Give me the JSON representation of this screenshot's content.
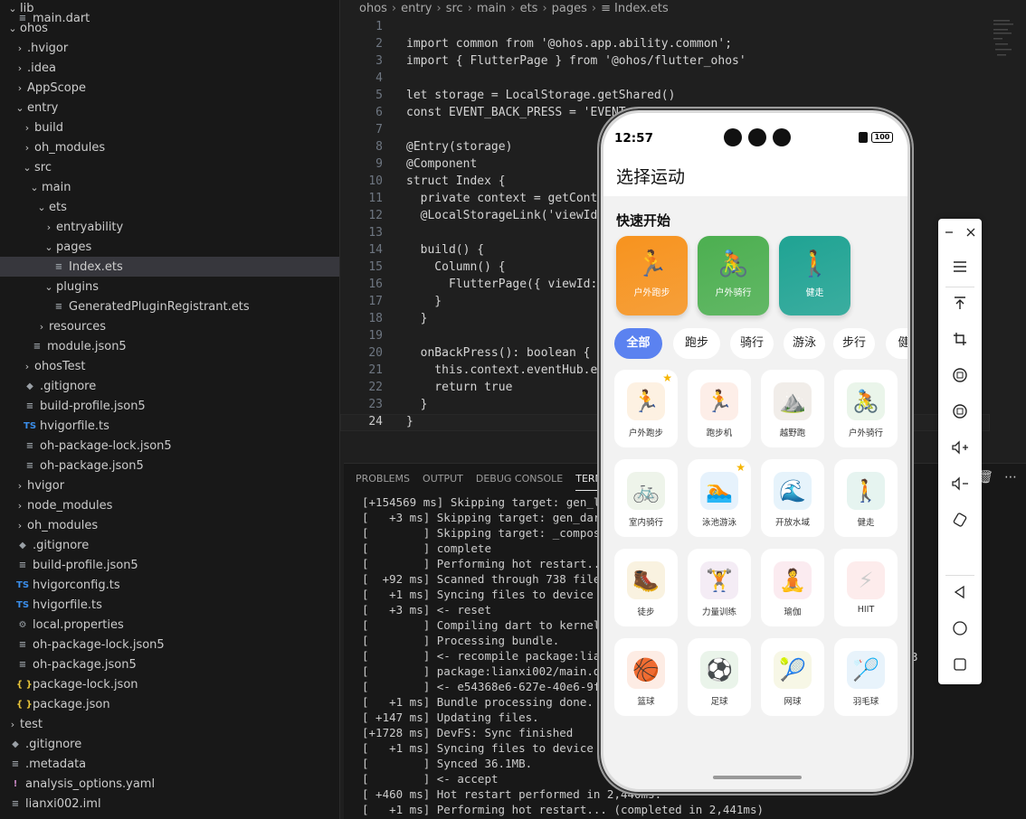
{
  "explorer": {
    "rows": [
      {
        "label": "lib",
        "icon": "chevron-down-icon",
        "type": "folder",
        "open": true
      },
      {
        "label": "main.dart",
        "type": "file"
      },
      {
        "label": "ohos",
        "type": "folder",
        "open": true
      },
      {
        "label": ".hvigor",
        "type": "folder",
        "open": false
      },
      {
        "label": ".idea",
        "type": "folder",
        "open": false
      },
      {
        "label": "AppScope",
        "type": "folder",
        "open": false
      },
      {
        "label": "entry",
        "type": "folder",
        "open": true
      },
      {
        "label": "build",
        "type": "folder",
        "open": false
      },
      {
        "label": "oh_modules",
        "type": "folder",
        "open": false
      },
      {
        "label": "src",
        "type": "folder",
        "open": true
      },
      {
        "label": "main",
        "type": "folder",
        "open": true
      },
      {
        "label": "ets",
        "type": "folder",
        "open": true
      },
      {
        "label": "entryability",
        "type": "folder",
        "open": false
      },
      {
        "label": "pages",
        "type": "folder",
        "open": true
      },
      {
        "label": "Index.ets",
        "type": "file",
        "icon": "lines-icon",
        "selected": true
      },
      {
        "label": "plugins",
        "type": "folder",
        "open": true
      },
      {
        "label": "GeneratedPluginRegistrant.ets",
        "type": "file",
        "icon": "lines-icon"
      },
      {
        "label": "resources",
        "type": "folder",
        "open": false
      },
      {
        "label": "module.json5",
        "type": "file",
        "icon": "lines-icon"
      },
      {
        "label": "ohosTest",
        "type": "folder",
        "open": false
      },
      {
        "label": ".gitignore",
        "type": "file",
        "icon": "diamond-icon"
      },
      {
        "label": "build-profile.json5",
        "type": "file",
        "icon": "lines-icon"
      },
      {
        "label": "hvigorfile.ts",
        "type": "file",
        "icon": "ts-icon"
      },
      {
        "label": "oh-package-lock.json5",
        "type": "file",
        "icon": "lines-icon"
      },
      {
        "label": "oh-package.json5",
        "type": "file",
        "icon": "lines-icon"
      },
      {
        "label": "hvigor",
        "type": "folder",
        "open": false
      },
      {
        "label": "node_modules",
        "type": "folder",
        "open": false
      },
      {
        "label": "oh_modules",
        "type": "folder",
        "open": false
      },
      {
        "label": ".gitignore",
        "type": "file",
        "icon": "diamond-icon"
      },
      {
        "label": "build-profile.json5",
        "type": "file",
        "icon": "lines-icon"
      },
      {
        "label": "hvigorconfig.ts",
        "type": "file",
        "icon": "ts-icon"
      },
      {
        "label": "hvigorfile.ts",
        "type": "file",
        "icon": "ts-icon"
      },
      {
        "label": "local.properties",
        "type": "file",
        "icon": "gear-icon"
      },
      {
        "label": "oh-package-lock.json5",
        "type": "file",
        "icon": "lines-icon"
      },
      {
        "label": "oh-package.json5",
        "type": "file",
        "icon": "lines-icon"
      },
      {
        "label": "package-lock.json",
        "type": "file",
        "icon": "braces-icon"
      },
      {
        "label": "package.json",
        "type": "file",
        "icon": "braces-icon"
      },
      {
        "label": "test",
        "type": "folder",
        "open": false
      },
      {
        "label": ".gitignore",
        "type": "file",
        "icon": "diamond-icon"
      },
      {
        "label": ".metadata",
        "type": "file",
        "icon": "lines-icon"
      },
      {
        "label": "analysis_options.yaml",
        "type": "file",
        "icon": "exclaim-icon"
      },
      {
        "label": "lianxi002.iml",
        "type": "file",
        "icon": "lines-icon"
      }
    ]
  },
  "breadcrumb": [
    "ohos",
    "entry",
    "src",
    "main",
    "ets",
    "pages",
    "Index.ets"
  ],
  "editor": {
    "line_numbers": [
      "1",
      "2",
      "3",
      "4",
      "5",
      "6",
      "7",
      "8",
      "9",
      "10",
      "11",
      "12",
      "13",
      "14",
      "15",
      "16",
      "17",
      "18",
      "19",
      "20",
      "21",
      "22",
      "23",
      "24"
    ],
    "lines": [
      "",
      "import common from '@ohos.app.ability.common';",
      "import { FlutterPage } from '@ohos/flutter_ohos'",
      "",
      "let storage = LocalStorage.getShared()",
      "const EVENT_BACK_PRESS = 'EVENT",
      "",
      "@Entry(storage)",
      "@Component",
      "struct Index {",
      "  private context = getConte",
      "  @LocalStorageLink('viewId",
      "",
      "  build() {",
      "    Column() {",
      "      FlutterPage({ viewId:",
      "    }",
      "  }",
      "",
      "  onBackPress(): boolean {",
      "    this.context.eventHub.em",
      "    return true",
      "  }",
      "}"
    ]
  },
  "panel": {
    "tabs": [
      "PROBLEMS",
      "OUTPUT",
      "DEBUG CONSOLE",
      "TERMINAL"
    ],
    "active_tab": "TERMINAL",
    "terminal_lines": [
      "[+154569 ms] Skipping target: gen_loc",
      "[   +3 ms] Skipping target: gen_dart_",
      "[        ] Skipping target: _composit",
      "[        ] complete",
      "[        ] Performing hot restart...",
      "[  +92 ms] Scanned through 738 files",
      "[   +1 ms] Syncing files to device 12",
      "[   +3 ms] <- reset",
      "[        ] Compiling dart to kernel w",
      "[        ] Processing bundle.",
      "[        ] <- recompile package:lianx",
      "[        ] package:lianxi002/main.dar",
      "[        ] <- e54368e6-627e-40e6-9ff3",
      "[   +1 ms] Bundle processing done.",
      "[ +147 ms] Updating files.",
      "[+1728 ms] DevFS: Sync finished",
      "[   +1 ms] Syncing files to device 12",
      "[        ] Synced 36.1MB.",
      "[        ] <- accept",
      "[ +460 ms] Hot restart performed in 2,440ms.",
      "[   +1 ms] Performing hot restart... (completed in 2,441ms)"
    ],
    "trailing_text": "3"
  },
  "phone": {
    "time": "12:57",
    "battery": "100",
    "title": "选择运动",
    "quick_title": "快速开始",
    "quick_cards": [
      {
        "label": "户外跑步",
        "emoji": "🏃",
        "color": "#f7931e"
      },
      {
        "label": "户外骑行",
        "emoji": "🚴",
        "color": "#4caf50"
      },
      {
        "label": "健走",
        "emoji": "🚶",
        "color": "#1fa393"
      }
    ],
    "chips": [
      "全部",
      "跑步",
      "骑行",
      "游泳",
      "步行",
      "健"
    ],
    "sports": [
      {
        "label": "户外跑步",
        "emoji": "🏃",
        "bg": "#fdf1e2",
        "star": true
      },
      {
        "label": "跑步机",
        "emoji": "🏃",
        "bg": "#fdeee8",
        "star": false
      },
      {
        "label": "越野跑",
        "emoji": "⛰️",
        "bg": "#f1ede9",
        "star": false
      },
      {
        "label": "户外骑行",
        "emoji": "🚴",
        "bg": "#eaf5ea",
        "star": false
      },
      {
        "label": "室内骑行",
        "emoji": "🚲",
        "bg": "#eef4ea",
        "star": false
      },
      {
        "label": "泳池游泳",
        "emoji": "🏊",
        "bg": "#e6f2fc",
        "star": true
      },
      {
        "label": "开放水域",
        "emoji": "🌊",
        "bg": "#e6f3fb",
        "star": false
      },
      {
        "label": "健走",
        "emoji": "🚶",
        "bg": "#e6f4f0",
        "star": false
      },
      {
        "label": "徒步",
        "emoji": "🥾",
        "bg": "#f9f2e0",
        "star": false
      },
      {
        "label": "力量训练",
        "emoji": "🏋️",
        "bg": "#f4ecf5",
        "star": false
      },
      {
        "label": "瑜伽",
        "emoji": "🧘",
        "bg": "#fbebf0",
        "star": false
      },
      {
        "label": "HIIT",
        "emoji": "⚡",
        "bg": "#fdecec",
        "star": false
      },
      {
        "label": "篮球",
        "emoji": "🏀",
        "bg": "#fdece4",
        "star": false
      },
      {
        "label": "足球",
        "emoji": "⚽",
        "bg": "#eaf4ea",
        "star": false
      },
      {
        "label": "网球",
        "emoji": "🎾",
        "bg": "#f7f7e6",
        "star": false
      },
      {
        "label": "羽毛球",
        "emoji": "🏸",
        "bg": "#e8f3fb",
        "star": false
      }
    ]
  },
  "emulator_toolbar": {
    "buttons": [
      "minimize-icon",
      "close-icon",
      "menu-icon",
      "pin-top-icon",
      "crop-icon",
      "rotate-left-icon",
      "rotate-right-icon",
      "volume-up-icon",
      "volume-down-icon",
      "shake-icon",
      "back-icon",
      "home-icon",
      "recents-icon"
    ]
  }
}
